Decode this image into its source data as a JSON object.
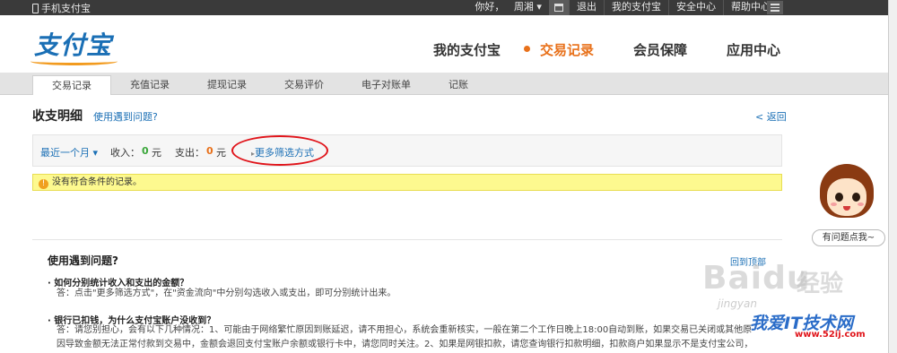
{
  "topbar": {
    "mobile": "手机支付宝",
    "greeting": "你好，",
    "user": "周湘",
    "logout": "退出",
    "my_alipay": "我的支付宝",
    "security": "安全中心",
    "help": "帮助中心"
  },
  "header": {
    "logo": "支付宝",
    "nav": [
      "我的支付宝",
      "交易记录",
      "会员保障",
      "应用中心"
    ]
  },
  "subnav": [
    "交易记录",
    "充值记录",
    "提现记录",
    "交易评价",
    "电子对账单",
    "记账"
  ],
  "page": {
    "title": "收支明细",
    "help_link": "使用遇到问题?",
    "back": "< 返回"
  },
  "filter": {
    "period": "最近一个月",
    "income_label": "收入：",
    "income_value": "0",
    "income_unit": "元",
    "expense_label": "支出：",
    "expense_value": "0",
    "expense_unit": "元",
    "more": "更多筛选方式"
  },
  "notice": {
    "text": "没有符合条件的记录。"
  },
  "help": {
    "title": "使用遇到问题?",
    "back_top": "回到顶部",
    "q1": "如何分别统计收入和支出的金额？",
    "a1": "答：点击\"更多筛选方式\"，在\"资金流向\"中分别勾选收入或支出，即可分别统计出来。",
    "q2": "银行已扣钱，为什么支付宝账户没收到？",
    "a2_line1": "答：请您别担心，会有以下几种情况：1、可能由于网络繁忙原因到账延迟，请不用担心，系统会重新核实，一般在第二个工作日晚上18:00自动到账，如果交易已关闭或其他原",
    "a2_line2": "因导致金额无法正常付款到交易中，金额会退回支付宝账户余额或银行卡中，请您同时关注。2、如果是网银扣款，请您查询银行扣款明细，扣款商户如果显示不是支付宝公司，"
  },
  "mascot": {
    "bubble": "有问题点我~"
  },
  "watermark": {
    "baidu": "Baidu",
    "jingyan": "经验",
    "sub": "jingyan",
    "site": "我爱IT技术网",
    "url": "www.52ij.com"
  }
}
